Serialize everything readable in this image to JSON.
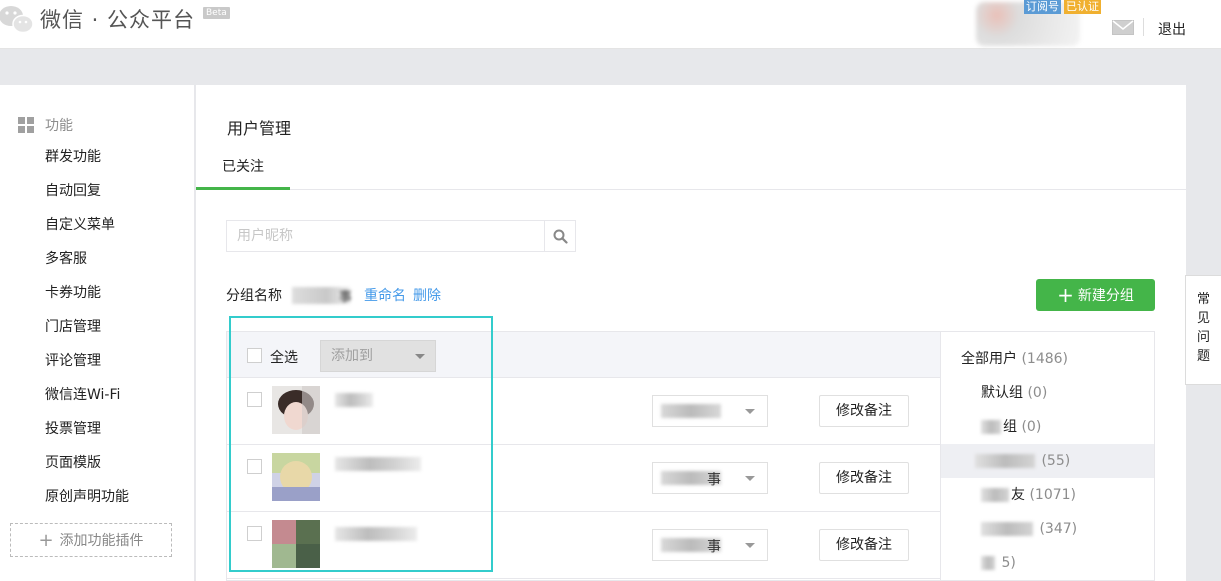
{
  "header": {
    "logo_text": "微信 · 公众平台",
    "beta_badge": "Beta",
    "account_badge_subscription": "订阅号",
    "account_badge_verified": "已认证",
    "logout_label": "退出",
    "mail_icon": "mail-icon"
  },
  "sidebar": {
    "section_title": "功能",
    "section_icon": "grid-icon",
    "items": [
      {
        "label": "群发功能"
      },
      {
        "label": "自动回复"
      },
      {
        "label": "自定义菜单"
      },
      {
        "label": "多客服"
      },
      {
        "label": "卡券功能"
      },
      {
        "label": "门店管理"
      },
      {
        "label": "评论管理"
      },
      {
        "label": "微信连Wi-Fi"
      },
      {
        "label": "投票管理"
      },
      {
        "label": "页面模版"
      },
      {
        "label": "原创声明功能"
      }
    ],
    "add_plugin_label": "添加功能插件"
  },
  "main": {
    "page_title": "用户管理",
    "tabs": [
      {
        "label": "已关注"
      }
    ],
    "search": {
      "placeholder": "用户昵称",
      "value": ""
    },
    "group_bar": {
      "label": "分组名称",
      "group_name_visible_tail": "事",
      "rename_label": "重命名",
      "delete_label": "删除"
    },
    "new_group_button": "新建分组",
    "table": {
      "select_all_label": "全选",
      "add_to_label": "添加到",
      "rows": [
        {
          "group_visible_text": "",
          "remark_button": "修改备注"
        },
        {
          "group_visible_text": "事",
          "remark_button": "修改备注"
        },
        {
          "group_visible_text": "事",
          "remark_button": "修改备注"
        }
      ]
    },
    "groups": [
      {
        "name": "全部用户",
        "count": "(1486)"
      },
      {
        "name": "默认组",
        "count": "(0)"
      },
      {
        "name": "组",
        "count": "(0)"
      },
      {
        "name": "",
        "count": "(55)"
      },
      {
        "name": "友",
        "count": "(1071)"
      },
      {
        "name": "",
        "count": "(347)"
      },
      {
        "name": "",
        "count": "5)"
      }
    ]
  },
  "faq": {
    "label": "常见问题"
  },
  "colors": {
    "brand_green": "#44b549",
    "link_blue": "#459ae9",
    "highlight_cyan": "#33cccc"
  }
}
